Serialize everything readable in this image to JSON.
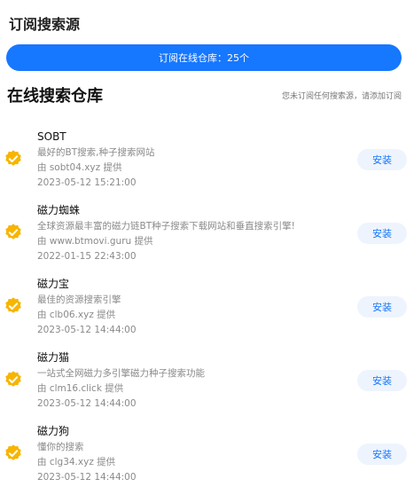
{
  "header": {
    "title": "订阅搜索源"
  },
  "banner": {
    "label": "订阅在线仓库：25个"
  },
  "section": {
    "title": "在线搜索仓库",
    "hint": "您未订阅任何搜索源，请添加订阅"
  },
  "colors": {
    "accent": "#1677ff",
    "badge": "#f7b500",
    "install_bg": "#eef4fd"
  },
  "items": [
    {
      "name": "SOBT",
      "desc": "最好的BT搜索,种子搜索网站",
      "provider": "由 sobt04.xyz 提供",
      "time": "2023-05-12 15:21:00",
      "action": "安装",
      "icon": "verified-badge-icon"
    },
    {
      "name": "磁力蜘蛛",
      "desc": "全球资源最丰富的磁力链BT种子搜索下载网站和垂直搜索引擎!",
      "provider": "由 www.btmovi.guru 提供",
      "time": "2022-01-15 22:43:00",
      "action": "安装",
      "icon": "verified-badge-icon"
    },
    {
      "name": "磁力宝",
      "desc": "最佳的资源搜索引擎",
      "provider": "由 clb06.xyz 提供",
      "time": "2023-05-12 14:44:00",
      "action": "安装",
      "icon": "verified-badge-icon"
    },
    {
      "name": "磁力猫",
      "desc": "一站式全网磁力多引擎磁力种子搜索功能",
      "provider": "由 clm16.click 提供",
      "time": "2023-05-12 14:44:00",
      "action": "安装",
      "icon": "verified-badge-icon"
    },
    {
      "name": "磁力狗",
      "desc": "懂你的搜索",
      "provider": "由 clg34.xyz 提供",
      "time": "2023-05-12 14:44:00",
      "action": "安装",
      "icon": "verified-badge-icon"
    }
  ]
}
